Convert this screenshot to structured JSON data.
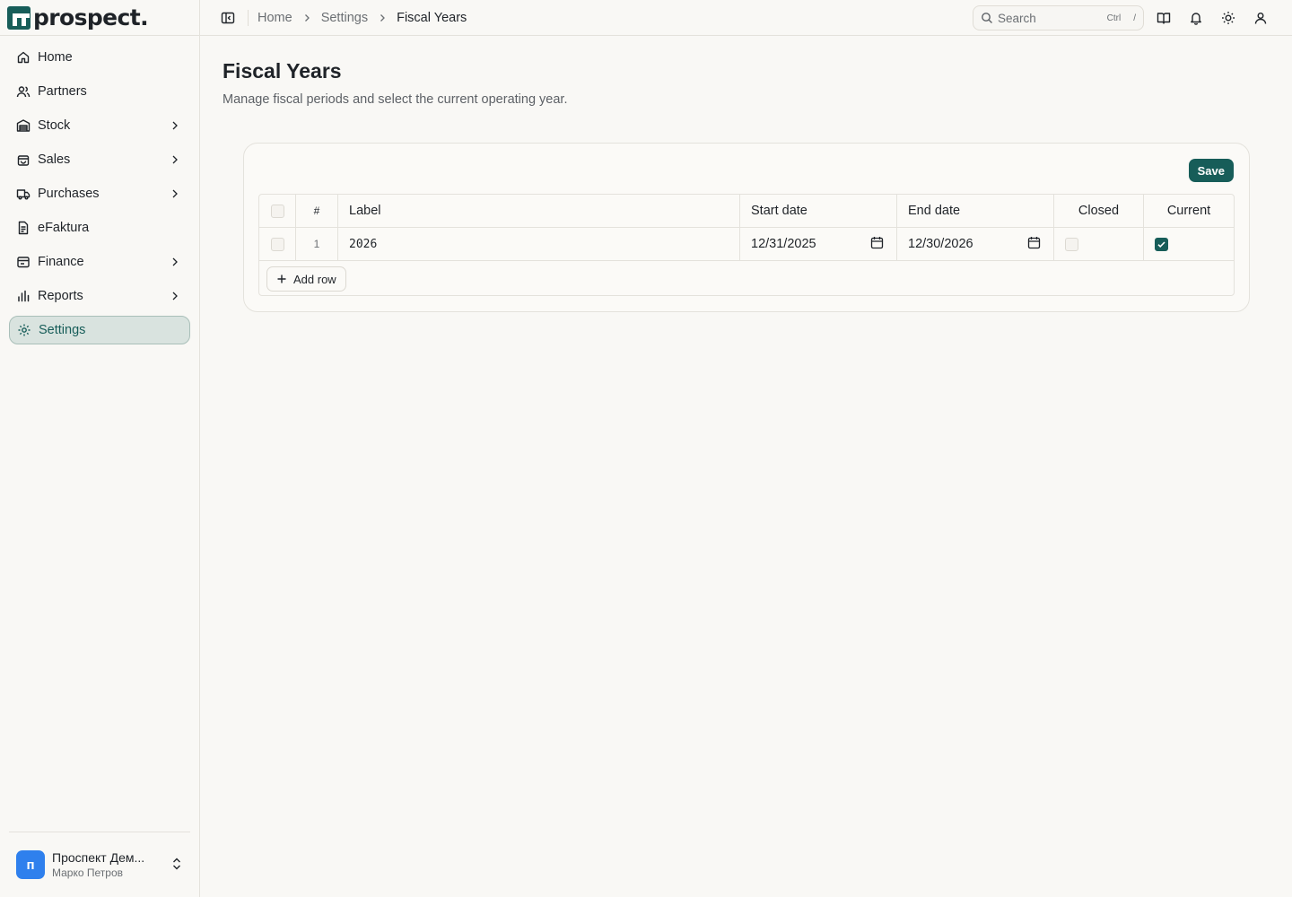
{
  "brand": {
    "name": "prospect."
  },
  "sidebar": {
    "items": [
      {
        "label": "Home",
        "icon": "home-icon",
        "has_children": false
      },
      {
        "label": "Partners",
        "icon": "users-icon",
        "has_children": false
      },
      {
        "label": "Stock",
        "icon": "warehouse-icon",
        "has_children": true
      },
      {
        "label": "Sales",
        "icon": "shopping-bag-icon",
        "has_children": true
      },
      {
        "label": "Purchases",
        "icon": "truck-icon",
        "has_children": true
      },
      {
        "label": "eFaktura",
        "icon": "document-icon",
        "has_children": false
      },
      {
        "label": "Finance",
        "icon": "wallet-icon",
        "has_children": true
      },
      {
        "label": "Reports",
        "icon": "bar-chart-icon",
        "has_children": true
      },
      {
        "label": "Settings",
        "icon": "gear-icon",
        "has_children": false,
        "active": true
      }
    ],
    "footer": {
      "avatar_letter": "п",
      "org_name": "Проспект Дем...",
      "user_name": "Марко Петров"
    }
  },
  "topbar": {
    "breadcrumb": [
      "Home",
      "Settings",
      "Fiscal Years"
    ],
    "search": {
      "placeholder": "Search",
      "shortcut_key1": "Ctrl",
      "shortcut_key2": "/"
    }
  },
  "page": {
    "title": "Fiscal Years",
    "subtitle": "Manage fiscal periods and select the current operating year."
  },
  "toolbar": {
    "save_label": "Save"
  },
  "table": {
    "columns": {
      "num": "#",
      "label": "Label",
      "start": "Start date",
      "end": "End date",
      "closed": "Closed",
      "current": "Current"
    },
    "rows": [
      {
        "num": "1",
        "label": "2026",
        "start_date": "12/31/2025",
        "end_date": "12/30/2026",
        "closed": false,
        "current": true
      }
    ],
    "add_row_label": "Add row"
  },
  "colors": {
    "accent": "#175d59",
    "active_nav_bg": "#d9e3df",
    "avatar": "#2f80ed"
  }
}
